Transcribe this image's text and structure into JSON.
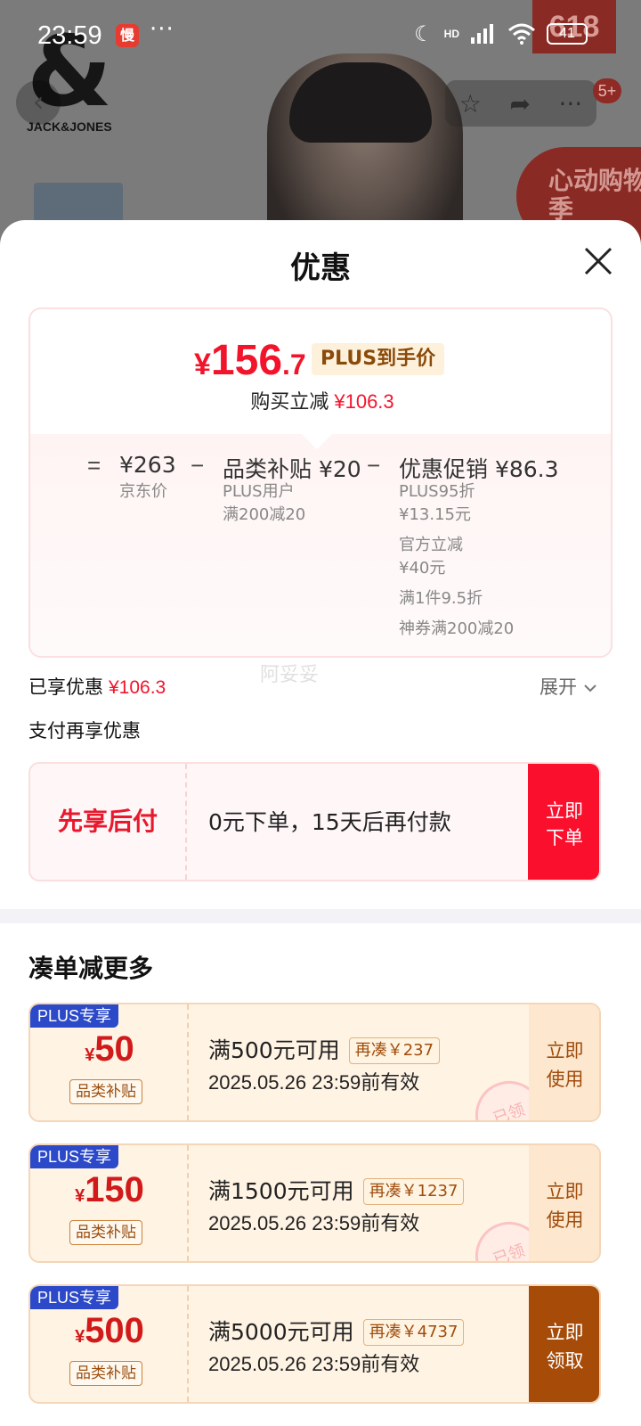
{
  "status_bar": {
    "time": "23:59",
    "app_badge": "慢",
    "more": "···",
    "network_label": "HD",
    "battery": "41"
  },
  "background": {
    "brand_logo_text": "JACK&JONES",
    "brand_logo_mark": "&",
    "badge_618": "618",
    "message_count": "5+",
    "promo_text": "心动购物季"
  },
  "sheet": {
    "title": "优惠"
  },
  "price_card": {
    "final_price_yen": "¥",
    "final_price_int": "156",
    "final_price_dec": ".7",
    "plus_tag": "PLUS到手价",
    "buy_cut_label": "购买立减",
    "buy_cut_value": "¥106.3",
    "equals": "=",
    "minus": "−",
    "jd_price": "¥263",
    "jd_price_label": "京东价",
    "category_subsidy": "品类补贴 ¥20",
    "category_sub_1": "PLUS用户",
    "category_sub_2": "满200减20",
    "promo": "优惠促销 ¥86.3",
    "promo_items": [
      "PLUS95折",
      "¥13.15元",
      "官方立减",
      "¥40元",
      "满1件9.5折",
      "神券满200减20"
    ]
  },
  "enjoyed": {
    "label": "已享优惠",
    "value": "¥106.3",
    "expand_label": "展开",
    "watermark": "阿妥妥",
    "pay_more_label": "支付再享优惠"
  },
  "bnpl": {
    "title": "先享后付",
    "desc": "0元下单，15天后再付款",
    "button_line1": "立即",
    "button_line2": "下单"
  },
  "more_section": {
    "title": "凑单减更多"
  },
  "coupons": [
    {
      "plus_label": "PLUS专享",
      "yen": "¥",
      "amount": "50",
      "category": "品类补贴",
      "condition": "满500元可用",
      "tag": "再凑￥237",
      "valid": "2025.05.26  23:59前有效",
      "button_line1": "立即",
      "button_line2": "使用",
      "stamp": "已领"
    },
    {
      "plus_label": "PLUS专享",
      "yen": "¥",
      "amount": "150",
      "category": "品类补贴",
      "condition": "满1500元可用",
      "tag": "再凑￥1237",
      "valid": "2025.05.26  23:59前有效",
      "button_line1": "立即",
      "button_line2": "使用",
      "stamp": "已领"
    },
    {
      "plus_label": "PLUS专享",
      "yen": "¥",
      "amount": "500",
      "category": "品类补贴",
      "condition": "满5000元可用",
      "tag": "再凑￥4737",
      "valid": "2025.05.26  23:59前有效",
      "button_line1": "立即",
      "button_line2": "领取"
    }
  ],
  "colors": {
    "price_red": "#f2142b",
    "plus_blue": "#2b49c8",
    "coupon_brown": "#a64b08",
    "coupon_bg": "#fff3e4"
  }
}
